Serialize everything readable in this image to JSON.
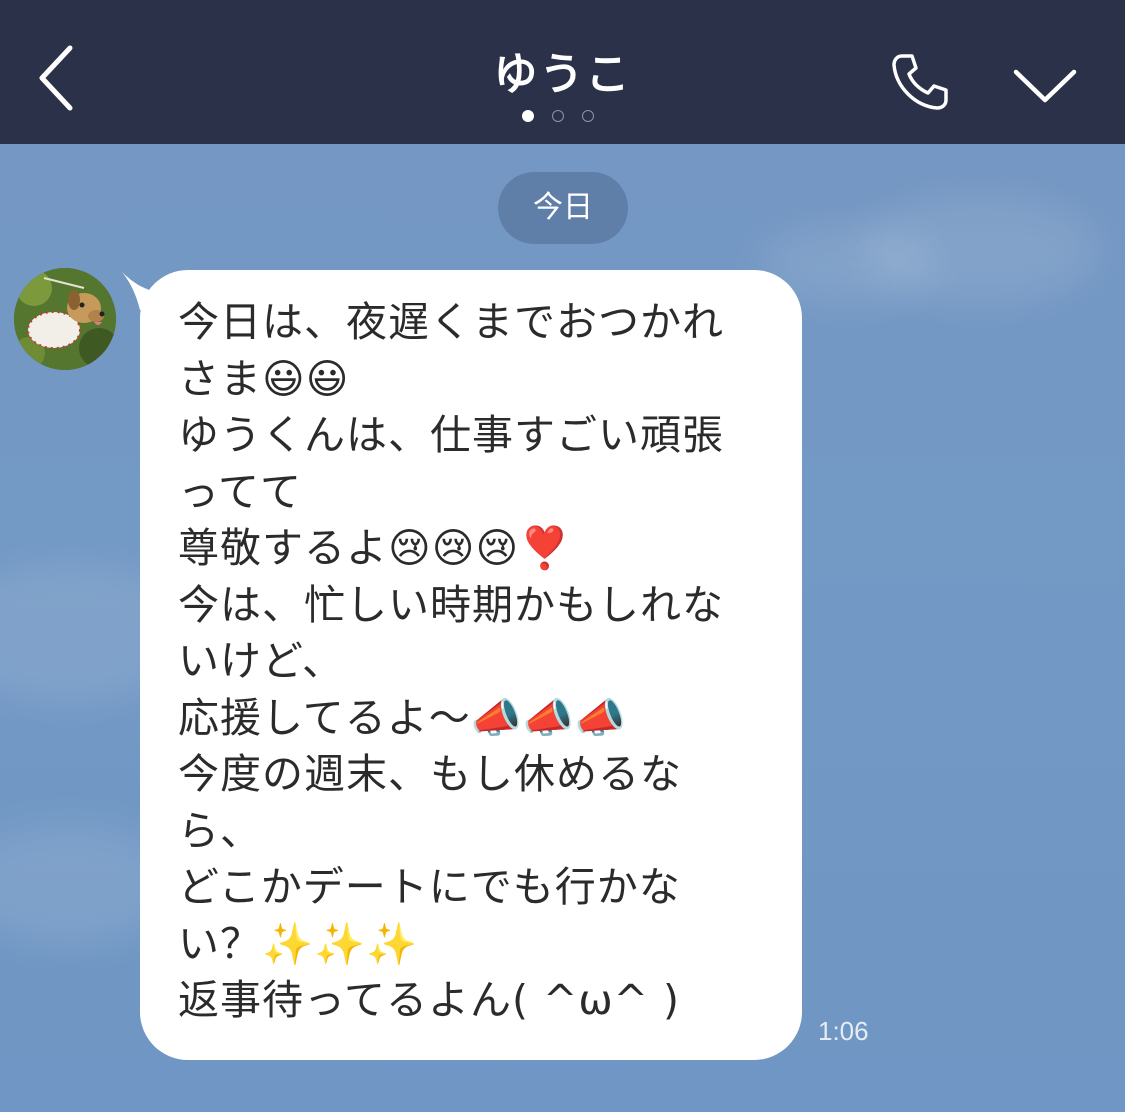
{
  "header": {
    "title": "ゆうこ",
    "back_icon": "chevron-left-icon",
    "call_icon": "phone-icon",
    "menu_icon": "chevron-down-icon",
    "page_dots": {
      "count": 3,
      "active_index": 0
    }
  },
  "chat": {
    "date_label": "今日",
    "message": {
      "sender_avatar": "dog-avatar",
      "lines": [
        "今日は、夜遅くまでおつかれ",
        "さま😃😃",
        "ゆうくんは、仕事すごい頑張",
        "ってて",
        "尊敬するよ😢😢😢❣️",
        "今は、忙しい時期かもしれな",
        "いけど、",
        "応援してるよ〜📣📣📣",
        "今度の週末、もし休めるな",
        "ら、",
        "どこかデートにでも行かな",
        "い？✨✨✨",
        "返事待ってるよん( ^ω^ )"
      ],
      "time": "1:06"
    }
  },
  "colors": {
    "header_bg": "#2a3148",
    "chat_bg": "#7397c2",
    "bubble_bg": "#ffffff",
    "date_pill_bg": "#5f7ea8"
  }
}
